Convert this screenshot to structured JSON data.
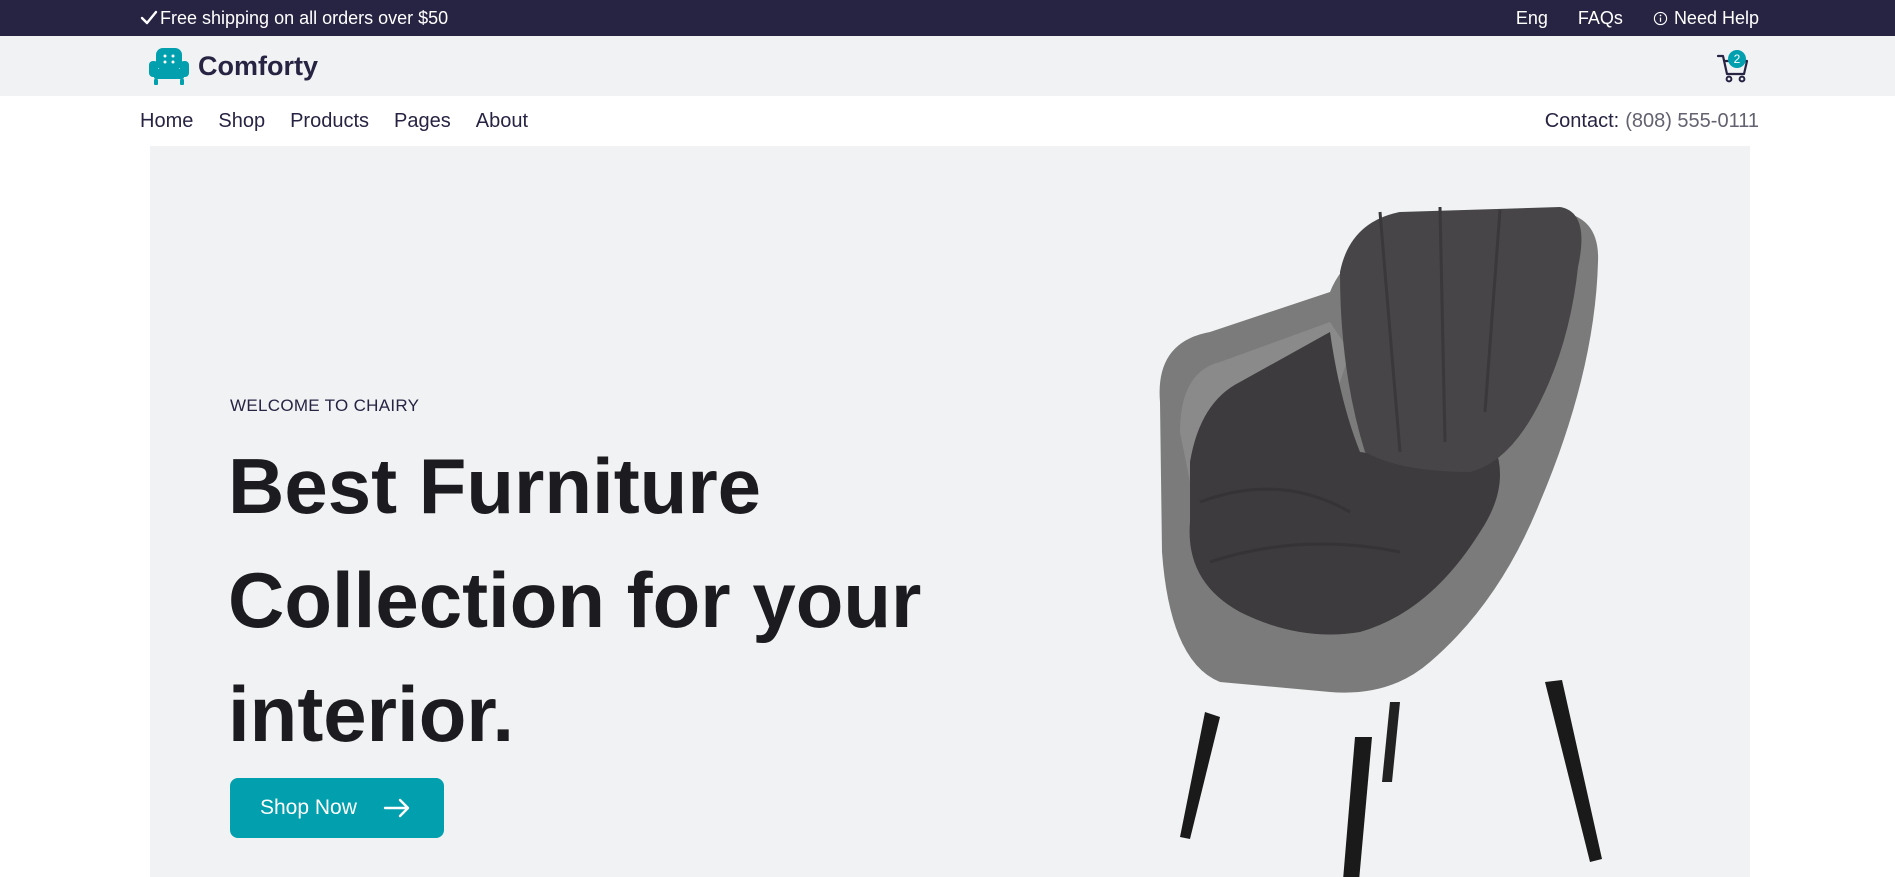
{
  "topbar": {
    "shipping_text": "Free shipping on all orders over $50",
    "language": "Eng",
    "faqs": "FAQs",
    "help": "Need Help",
    "background": "#272343"
  },
  "header": {
    "brand": "Comforty",
    "cart_count": "2",
    "accent": "#029fae"
  },
  "nav": {
    "items": [
      "Home",
      "Shop",
      "Products",
      "Pages",
      "About"
    ],
    "contact_label": "Contact:",
    "contact_phone": "(808) 555-0111"
  },
  "hero": {
    "eyebrow": "WELCOME TO CHAIRY",
    "headline": "Best Furniture Collection for your interior.",
    "cta_label": "Shop Now",
    "image": "armchair-photo"
  }
}
